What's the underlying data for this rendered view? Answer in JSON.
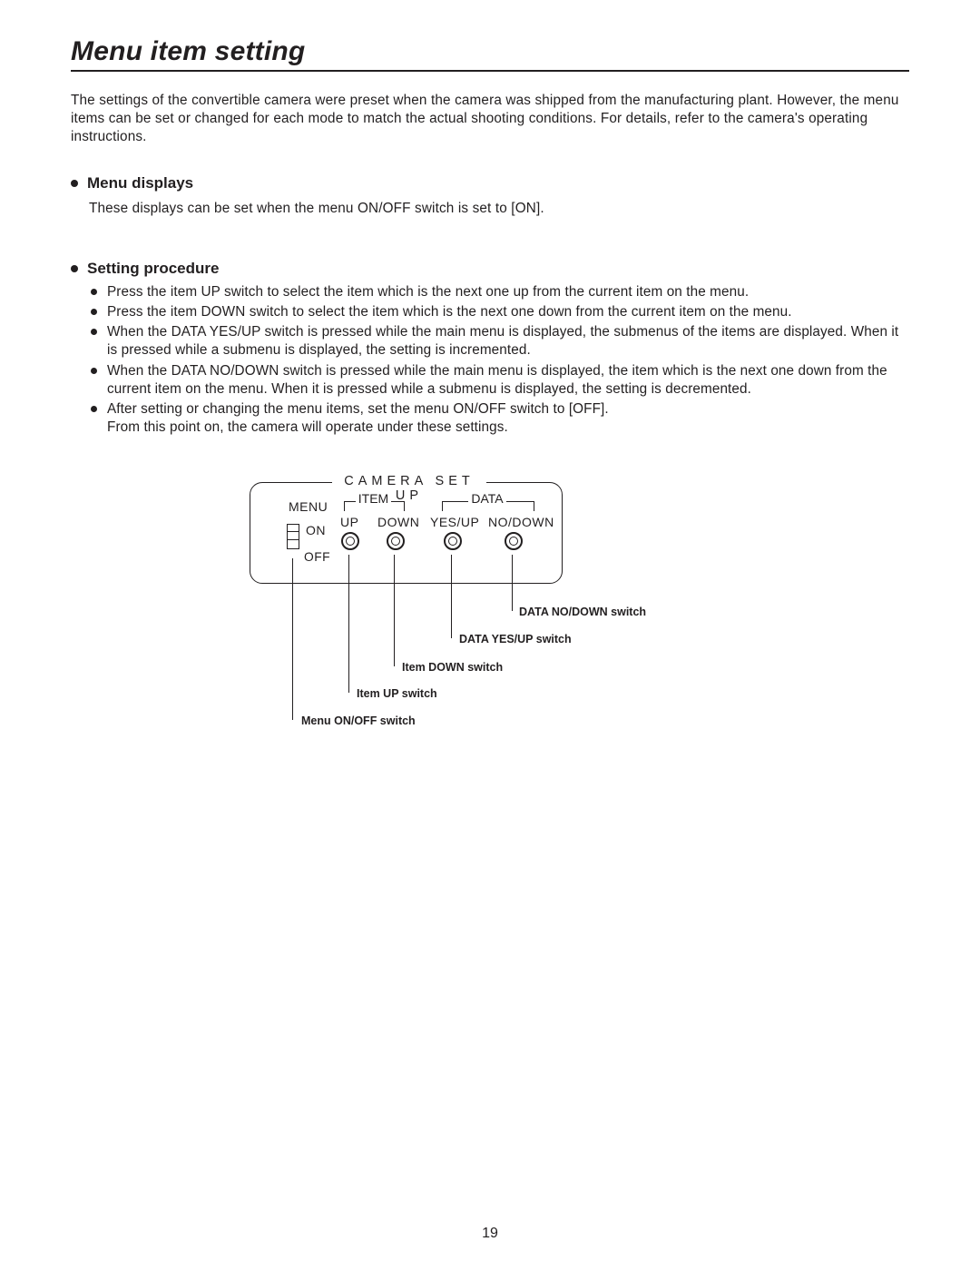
{
  "title": "Menu item setting",
  "intro": "The settings of the convertible camera were preset when the camera was shipped from the manufacturing plant. However, the menu items can be set or changed for each mode to match the actual shooting conditions. For details, refer to the camera's operating instructions.",
  "sections": {
    "menu_displays": {
      "heading": "Menu displays",
      "body": "These displays can be set when the menu ON/OFF switch is set to [ON]."
    },
    "setting_procedure": {
      "heading": "Setting procedure",
      "bullets": [
        "Press the item UP switch to select the item which is the next one up from the current item on the menu.",
        "Press the item DOWN switch to select the item which is the next one down from the current item on the menu.",
        "When the DATA YES/UP switch is pressed while the main menu is displayed, the submenus of the items are displayed. When it is pressed while a submenu is displayed, the setting is incremented.",
        "When the DATA NO/DOWN switch is pressed while the main menu is displayed, the item which is the next one down from the current item on the menu. When it is pressed while a submenu is displayed, the setting is decremented.",
        "After setting or changing the menu items, set the menu ON/OFF switch to [OFF].\nFrom this point on, the camera will operate under these settings."
      ]
    }
  },
  "diagram": {
    "panel_title": "CAMERA  SET  UP",
    "menu": "MENU",
    "on": "ON",
    "off": "OFF",
    "item": "ITEM",
    "data": "DATA",
    "up": "UP",
    "down": "DOWN",
    "yesup": "YES/UP",
    "nodown": "NO/DOWN",
    "callouts": {
      "menu_switch": "Menu ON/OFF switch",
      "item_up": "Item UP switch",
      "item_down": "Item DOWN switch",
      "data_yesup": "DATA YES/UP switch",
      "data_nodown": "DATA NO/DOWN switch"
    }
  },
  "page_number": "19"
}
